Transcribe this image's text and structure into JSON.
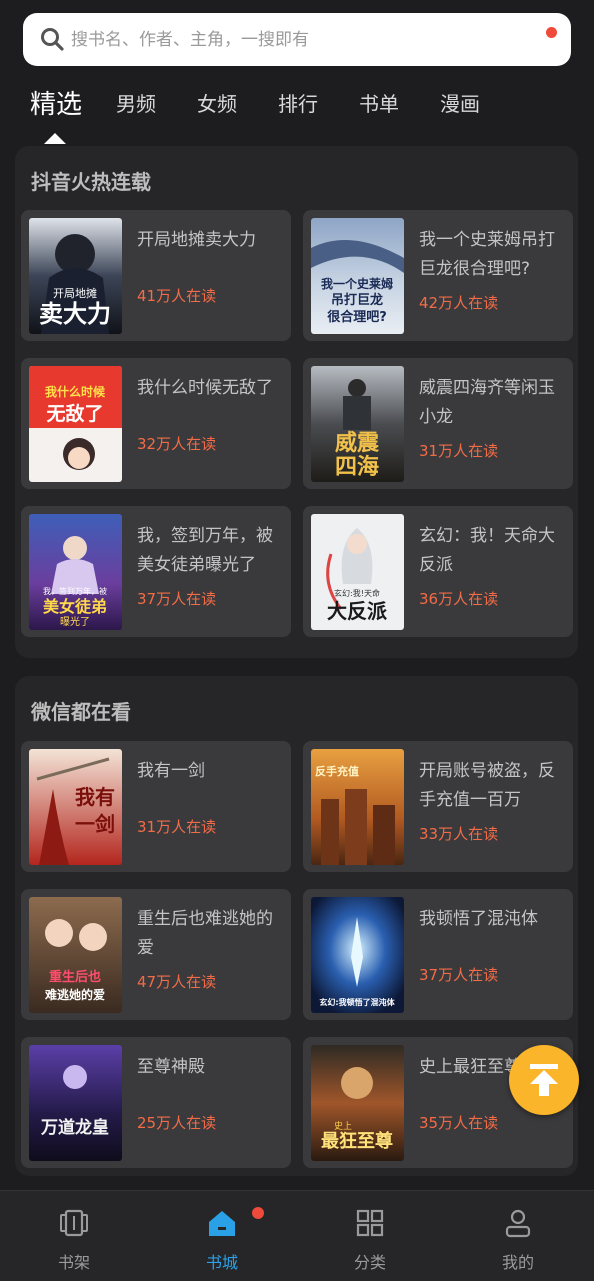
{
  "search": {
    "placeholder": "搜书名、作者、主角，一搜即有"
  },
  "tabs": [
    {
      "label": "精选",
      "active": true
    },
    {
      "label": "男频"
    },
    {
      "label": "女频"
    },
    {
      "label": "排行"
    },
    {
      "label": "书单"
    },
    {
      "label": "漫画"
    }
  ],
  "sections": [
    {
      "title": "抖音火热连载",
      "books": [
        {
          "title": "开局地摊卖大力",
          "readers": "41万人在读",
          "cover_icon": "cover-dark-hero"
        },
        {
          "title": "我一个史莱姆吊打巨龙很合理吧?",
          "readers": "42万人在读",
          "cover_icon": "cover-blue-dragon"
        },
        {
          "title": "我什么时候无敌了",
          "readers": "32万人在读",
          "cover_icon": "cover-red-chibi"
        },
        {
          "title": "威震四海齐等闲玉小龙",
          "readers": "31万人在读",
          "cover_icon": "cover-gold-soldier"
        },
        {
          "title": "我，签到万年，被美女徒弟曝光了",
          "readers": "37万人在读",
          "cover_icon": "cover-purple-fairy"
        },
        {
          "title": "玄幻：我！天命大反派",
          "readers": "36万人在读",
          "cover_icon": "cover-white-villain"
        }
      ]
    },
    {
      "title": "微信都在看",
      "books": [
        {
          "title": "我有一剑",
          "readers": "31万人在读",
          "cover_icon": "cover-red-sword"
        },
        {
          "title": "开局账号被盗，反手充值一百万",
          "readers": "33万人在读",
          "cover_icon": "cover-orange-city"
        },
        {
          "title": "重生后也难逃她的爱",
          "readers": "47万人在读",
          "cover_icon": "cover-brown-girls"
        },
        {
          "title": "我顿悟了混沌体",
          "readers": "37万人在读",
          "cover_icon": "cover-blue-chaos"
        },
        {
          "title": "至尊神殿",
          "readers": "25万人在读",
          "cover_icon": "cover-purple-dragon-emperor"
        },
        {
          "title": "史上最狂至尊",
          "readers": "35万人在读",
          "cover_icon": "cover-gold-warrior"
        }
      ]
    }
  ],
  "cover_text": {
    "b0": [
      "开局地摊",
      "卖大力"
    ],
    "b1": [
      "我一个史莱姆",
      "吊打巨龙",
      "很合理吧?"
    ],
    "b2": [
      "我什么时候",
      "无敌了"
    ],
    "b3": [
      "威震",
      "四海"
    ],
    "b4": [
      "我，签到万年，被",
      "美女徒弟",
      "曝光了"
    ],
    "b5": [
      "玄幻:我!天命",
      "大反派"
    ],
    "b6": [
      "我有",
      "一剑"
    ],
    "b7": [
      "反手充值"
    ],
    "b8": [
      "重生后也",
      "难逃她的爱"
    ],
    "b9": [
      "玄幻:我顿悟了混沌体"
    ],
    "b10": [
      "万道龙皇"
    ],
    "b11": [
      "史上",
      "最狂至尊"
    ]
  },
  "bottom_nav": [
    {
      "label": "书架",
      "icon": "bookshelf-icon"
    },
    {
      "label": "书城",
      "icon": "home-icon",
      "active": true
    },
    {
      "label": "分类",
      "icon": "grid-icon"
    },
    {
      "label": "我的",
      "icon": "user-icon"
    }
  ],
  "colors": {
    "accent": "#2aa1e6",
    "readers": "#f36c47",
    "fab": "#fbb52b",
    "badge": "#f04b3a"
  }
}
